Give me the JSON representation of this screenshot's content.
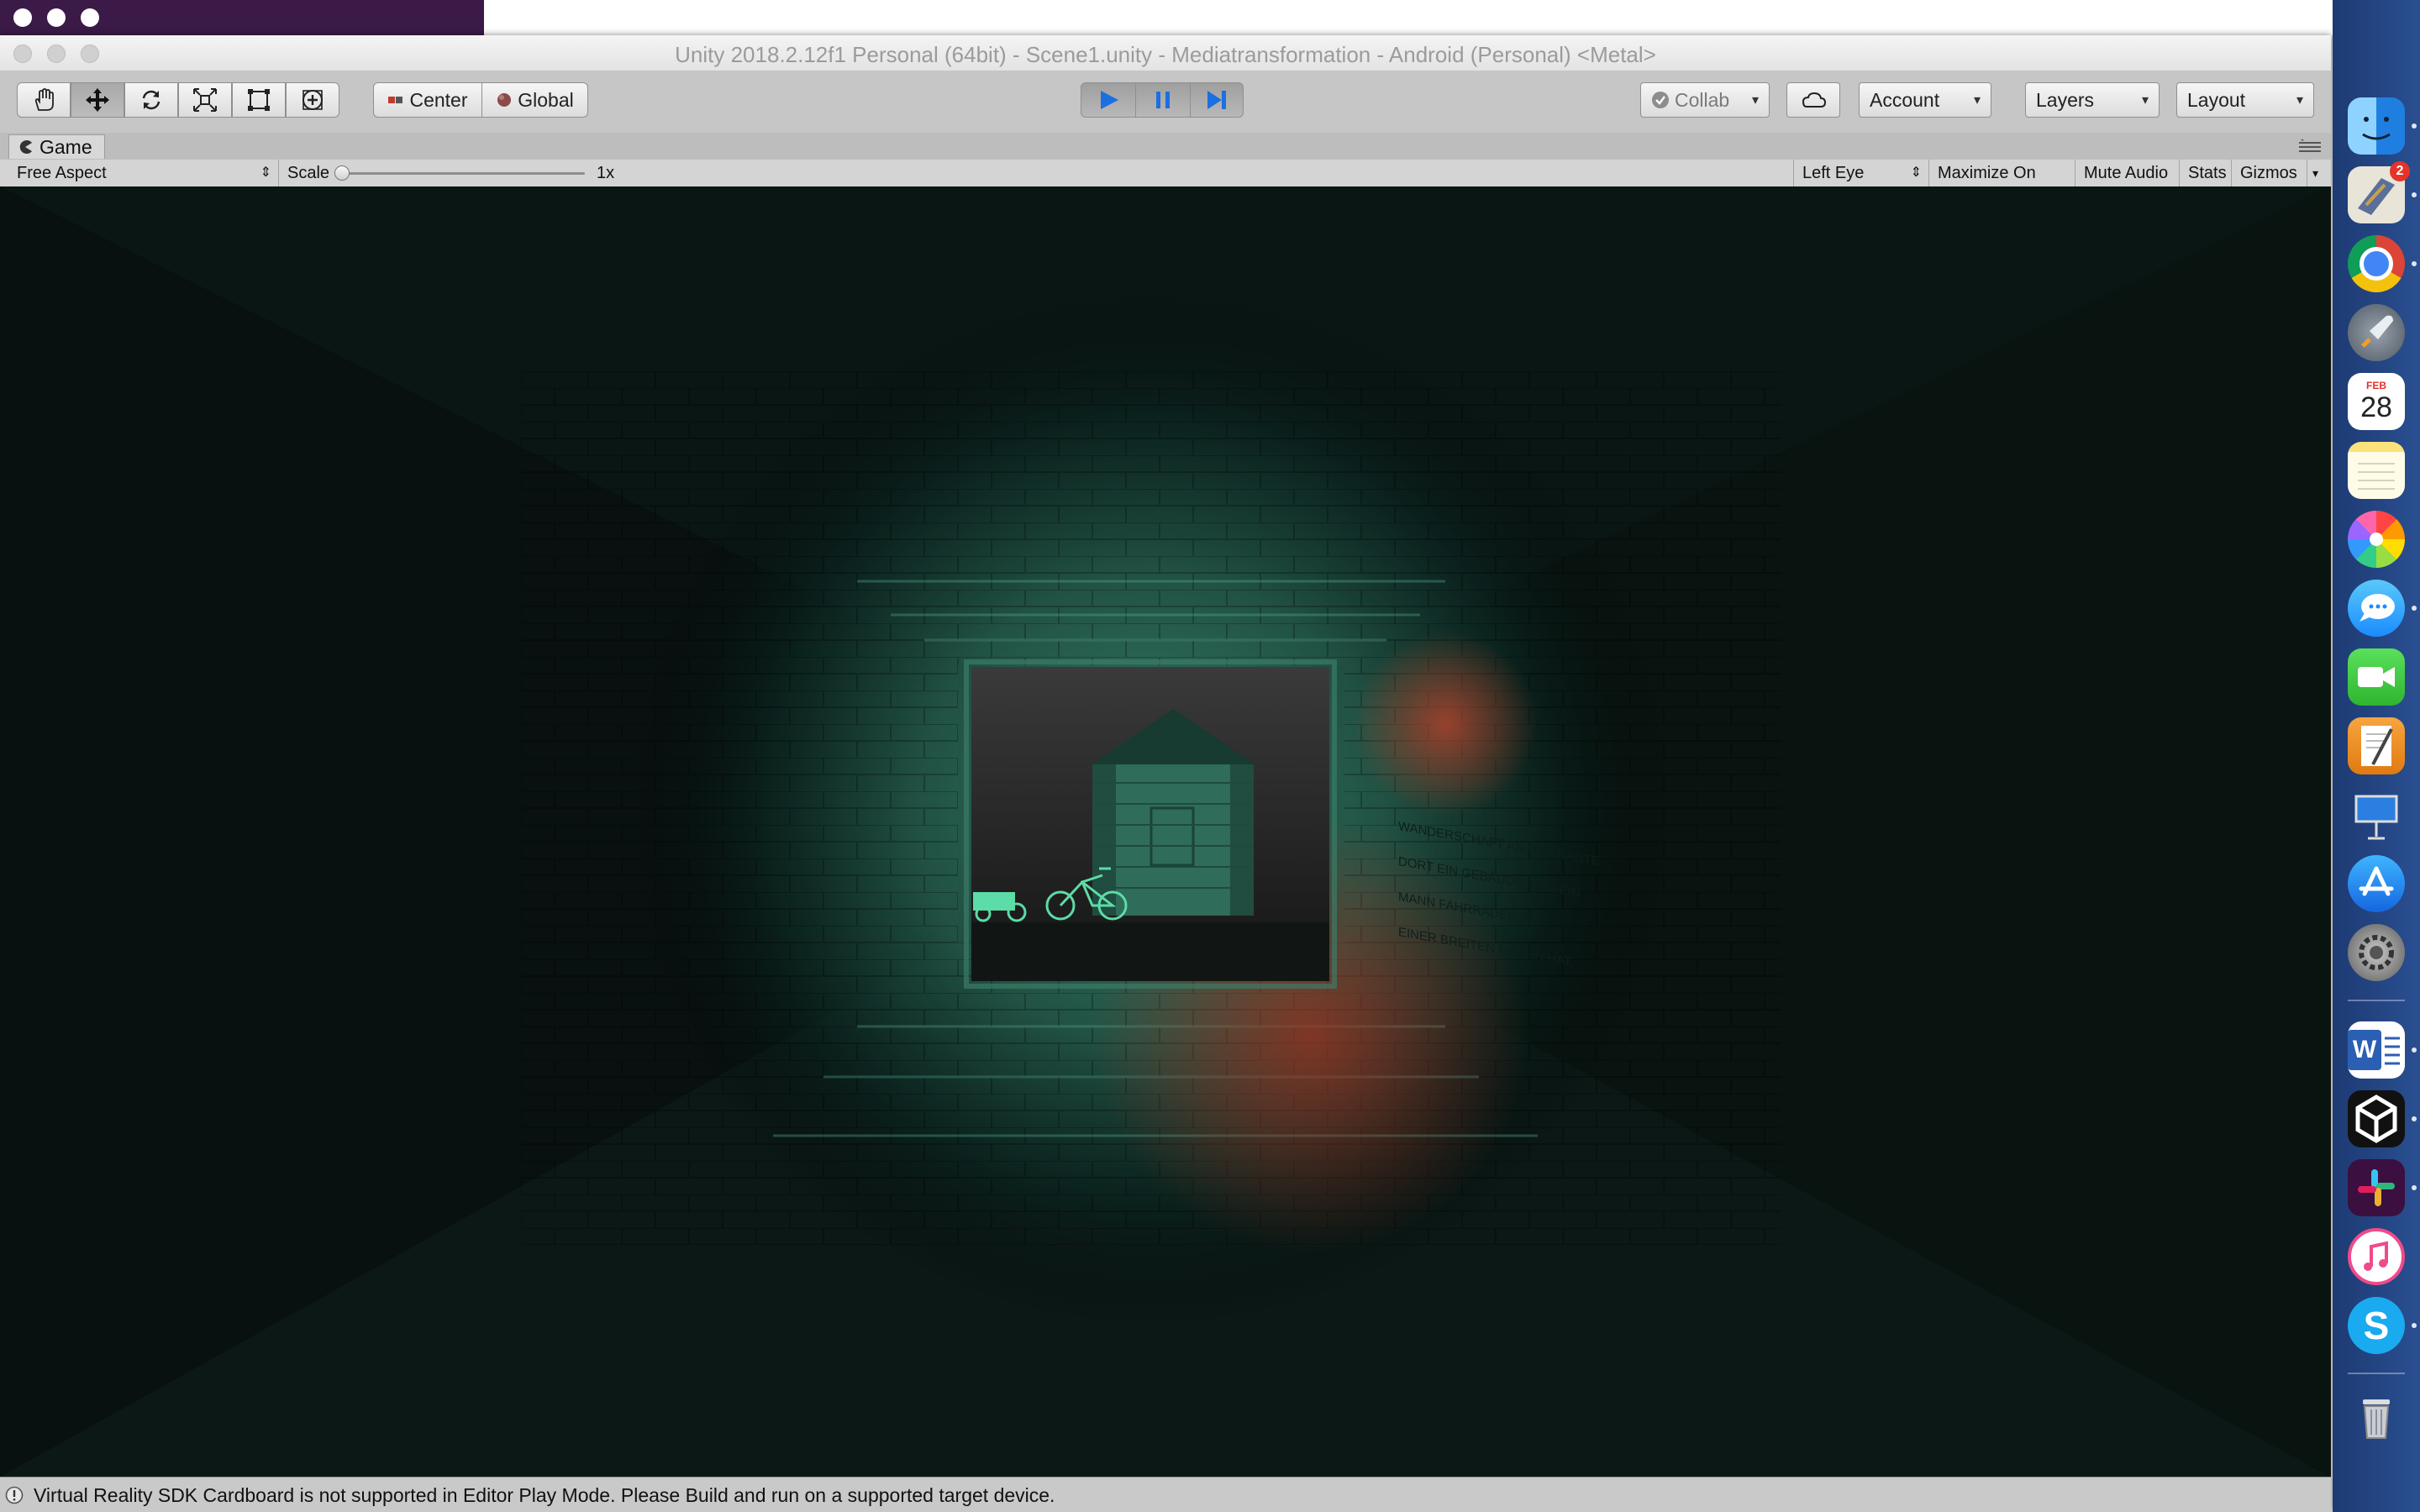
{
  "window": {
    "title": "Unity 2018.2.12f1 Personal (64bit) - Scene1.unity - Mediatransformation - Android (Personal) <Metal>"
  },
  "toolbar": {
    "tools": [
      "hand-tool",
      "move-tool",
      "rotate-tool",
      "scale-tool",
      "rect-tool",
      "transform-tool"
    ],
    "active_tool": "move-tool",
    "pivot_center_label": "Center",
    "pivot_global_label": "Global",
    "collab_label": "Collab",
    "account_label": "Account",
    "layers_label": "Layers",
    "layout_label": "Layout",
    "play_state": "playing"
  },
  "game_tab": {
    "label": "Game"
  },
  "game_toolbar": {
    "aspect": "Free Aspect",
    "scale_label": "Scale",
    "scale_value": "1x",
    "scale_fraction": 0.0,
    "eye": "Left Eye",
    "maximize_label": "Maximize On Play",
    "mute_label": "Mute Audio",
    "stats_label": "Stats",
    "gizmos_label": "Gizmos"
  },
  "scene": {
    "wall_text": [
      "WANDERSCHAFT AN DER KANTE",
      "DORT EIN GEBÄUDE, DAS EIN",
      "MANN FAHRRÄDER MIT",
      "EINER BREITEN HÖHEN HAT."
    ],
    "colors": {
      "tunnel": "#2f6f5c",
      "glow": "#2e9e7c",
      "red_light": "#8a2a1c",
      "background": "#020708"
    }
  },
  "status": {
    "message": "Virtual Reality SDK Cardboard is not supported in Editor Play Mode. Please Build and run on a supported target device."
  },
  "dock": {
    "apps": [
      "finder-icon",
      "mail-icon",
      "chrome-icon",
      "launchpad-icon",
      "calendar-icon",
      "notes-icon",
      "photos-icon",
      "messages-icon",
      "facetime-icon",
      "pages-icon",
      "keynote-icon",
      "app-store-icon",
      "system-preferences-icon",
      "word-icon",
      "unity-icon",
      "slack-icon",
      "itunes-icon",
      "skype-icon",
      "trash-icon"
    ],
    "mail_badge": "2",
    "calendar_month": "FEB",
    "calendar_day": "28"
  }
}
